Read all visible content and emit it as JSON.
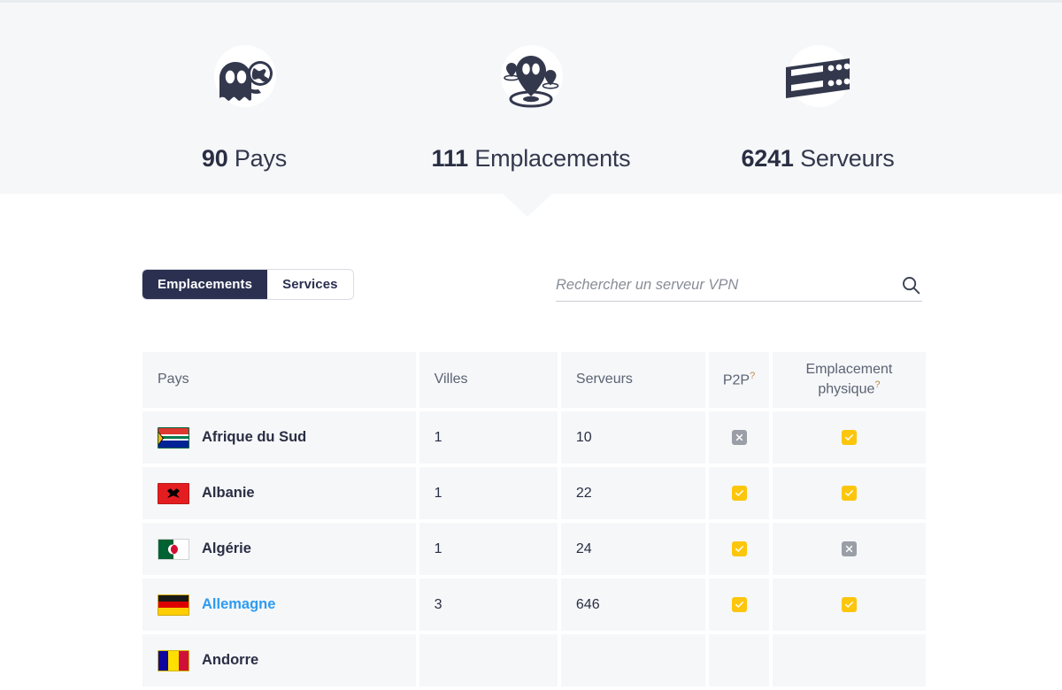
{
  "hero": {
    "stats": [
      {
        "icon": "ghost-globe-icon",
        "number": "90",
        "label": "Pays"
      },
      {
        "icon": "map-pins-icon",
        "number": "111",
        "label": "Emplacements"
      },
      {
        "icon": "servers-icon",
        "number": "6241",
        "label": "Serveurs"
      }
    ]
  },
  "controls": {
    "tabs": [
      {
        "label": "Emplacements",
        "active": true
      },
      {
        "label": "Services",
        "active": false
      }
    ],
    "search": {
      "value": "",
      "placeholder": "Rechercher un serveur VPN",
      "icon": "search-icon"
    }
  },
  "table": {
    "headers": {
      "pays": "Pays",
      "villes": "Villes",
      "serveurs": "Serveurs",
      "p2p": "P2P",
      "p2p_sup": "?",
      "physique_line1": "Emplacement",
      "physique_line2": "physique",
      "physique_sup": "?"
    },
    "rows": [
      {
        "flag": "fl-za",
        "country": "Afrique du Sud",
        "link": false,
        "villes": "1",
        "serveurs": "10",
        "p2p": "no",
        "physique": "yes"
      },
      {
        "flag": "fl-al",
        "country": "Albanie",
        "link": false,
        "villes": "1",
        "serveurs": "22",
        "p2p": "yes",
        "physique": "yes"
      },
      {
        "flag": "fl-dz",
        "country": "Algérie",
        "link": false,
        "villes": "1",
        "serveurs": "24",
        "p2p": "yes",
        "physique": "no"
      },
      {
        "flag": "fl-de",
        "country": "Allemagne",
        "link": true,
        "villes": "3",
        "serveurs": "646",
        "p2p": "yes",
        "physique": "yes"
      },
      {
        "flag": "fl-ad",
        "country": "Andorre",
        "link": false,
        "villes": "",
        "serveurs": "",
        "p2p": "",
        "physique": ""
      }
    ]
  },
  "colors": {
    "hero_bg": "#f5f7f9",
    "tab_active_bg": "#2b3050",
    "link_blue": "#2e9bf0",
    "check_yellow": "#fcc60c",
    "cross_gray": "#9a9ea6",
    "sup_orange": "#c08a4a"
  }
}
